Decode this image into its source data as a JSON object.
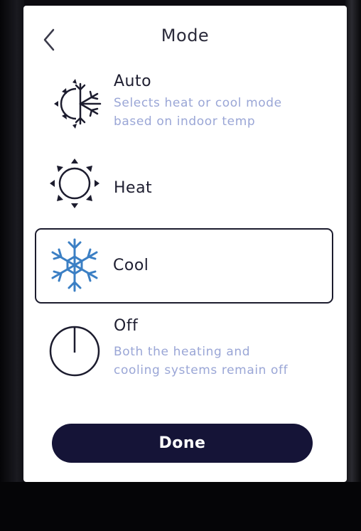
{
  "header": {
    "title": "Mode",
    "back_icon": "chevron-left-icon"
  },
  "options": [
    {
      "id": "auto",
      "label": "Auto",
      "description_line1": "Selects heat or cool mode",
      "description_line2": "based on indoor temp",
      "icon": "sun-snowflake-icon",
      "selected": false
    },
    {
      "id": "heat",
      "label": "Heat",
      "icon": "sun-icon",
      "selected": false
    },
    {
      "id": "cool",
      "label": "Cool",
      "icon": "snowflake-icon",
      "selected": true
    },
    {
      "id": "off",
      "label": "Off",
      "description_line1": "Both the heating and",
      "description_line2": "cooling systems remain off",
      "icon": "power-icon",
      "selected": false
    }
  ],
  "done_label": "Done",
  "colors": {
    "text": "#1e1e30",
    "description": "#9aa6d6",
    "snowflake": "#3b7fc4",
    "done_button": "#151437",
    "selected_border": "#1c1c2e"
  }
}
